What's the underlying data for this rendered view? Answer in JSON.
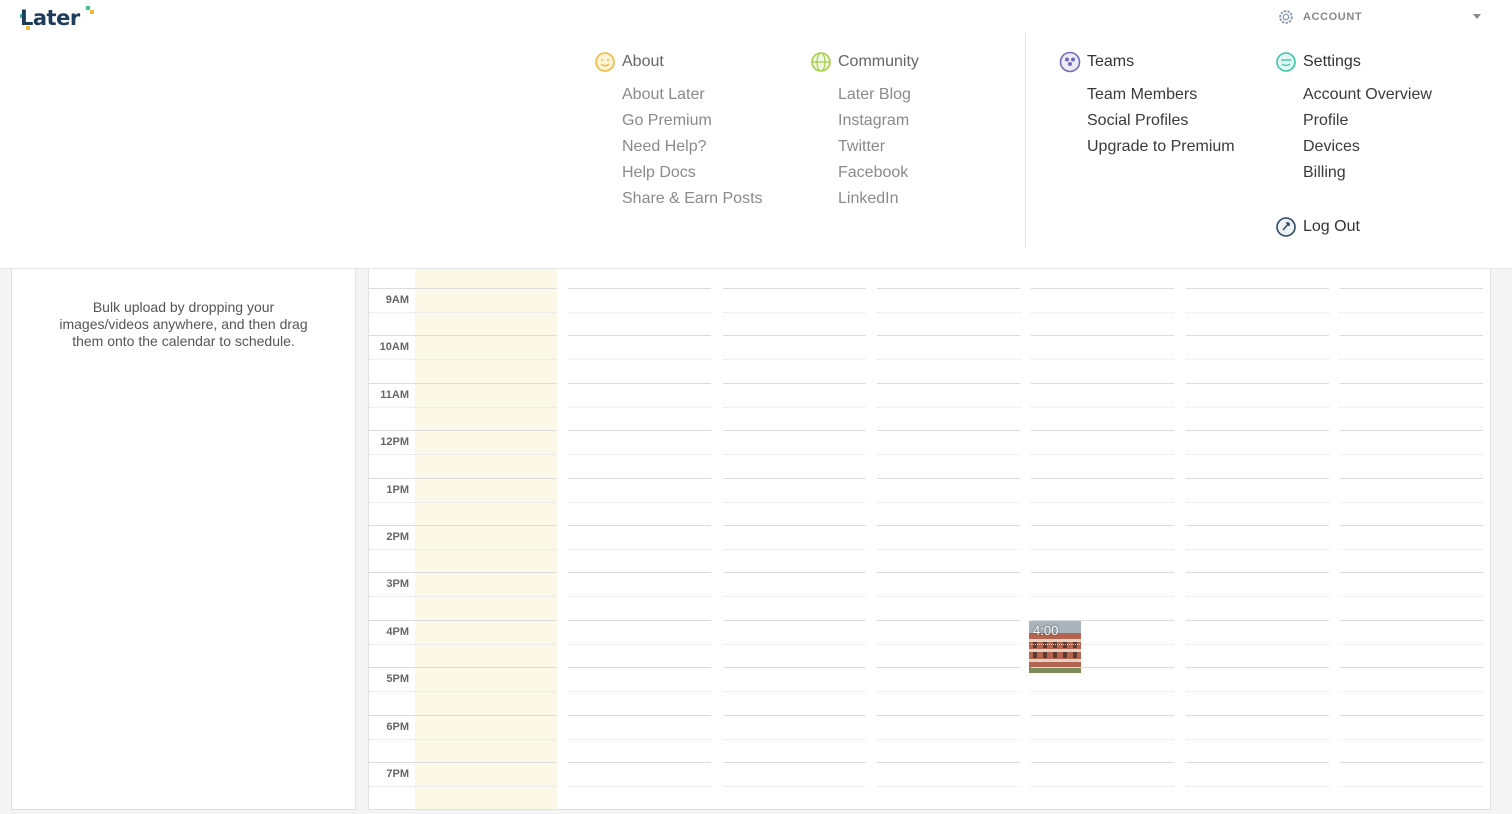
{
  "header": {
    "logo_text": "Later",
    "account_label": "ACCOUNT"
  },
  "menu": {
    "about": {
      "title": "About",
      "items": [
        "About Later",
        "Go Premium",
        "Need Help?",
        "Help Docs",
        "Share & Earn Posts"
      ]
    },
    "community": {
      "title": "Community",
      "items": [
        "Later Blog",
        "Instagram",
        "Twitter",
        "Facebook",
        "LinkedIn"
      ]
    },
    "teams": {
      "title": "Teams",
      "items": [
        "Team Members",
        "Social Profiles",
        "Upgrade to Premium"
      ]
    },
    "settings": {
      "title": "Settings",
      "items": [
        "Account Overview",
        "Profile",
        "Devices",
        "Billing"
      ]
    },
    "logout_label": "Log Out"
  },
  "upload": {
    "lines": [
      "Bulk upload by dropping your",
      "images/videos anywhere, and then drag",
      "them onto the calendar to schedule."
    ]
  },
  "calendar": {
    "hours": [
      "9AM",
      "10AM",
      "11AM",
      "12PM",
      "1PM",
      "2PM",
      "3PM",
      "4PM",
      "5PM",
      "6PM",
      "7PM"
    ],
    "scheduled_post": {
      "time": "4:00"
    }
  },
  "colors": {
    "brand_dark": "#1f3b5a",
    "today_column": "#fbf8e8",
    "about_icon": "#f0b93a",
    "community_icon": "#a6cf4a",
    "teams_icon": "#6f6bb8",
    "settings_icon": "#3cc6a8"
  }
}
